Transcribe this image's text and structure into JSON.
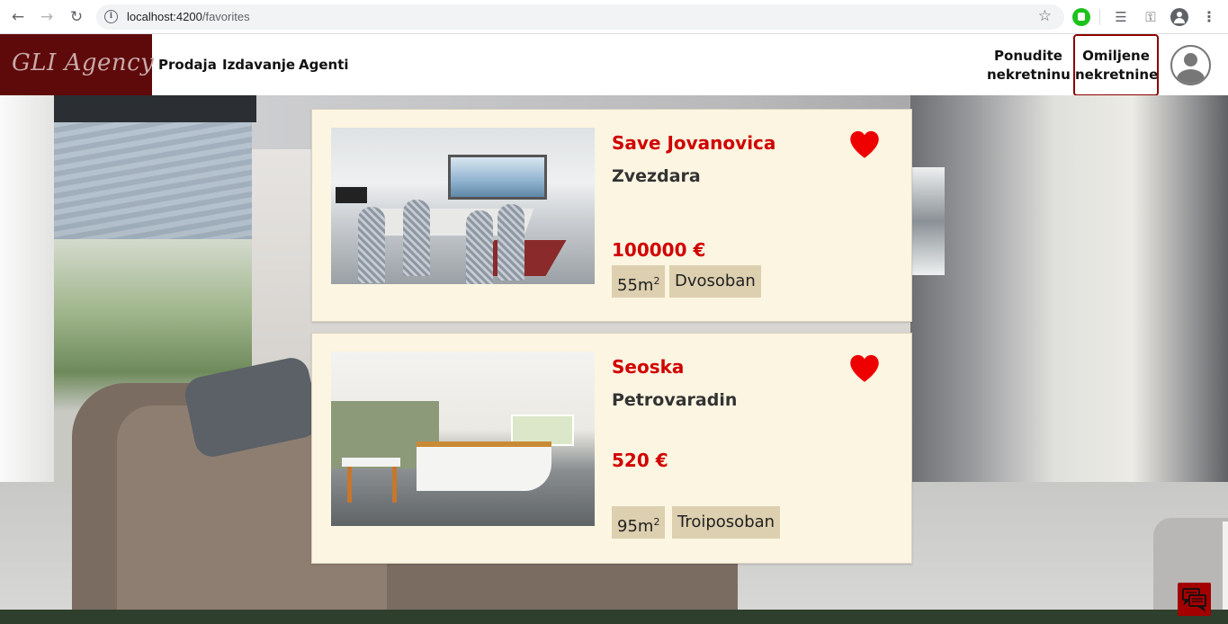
{
  "browser": {
    "url_host": "localhost:4200",
    "url_path": "/favorites"
  },
  "navbar": {
    "logo": "GLI Agency",
    "links": [
      "Prodaja",
      "Izdavanje",
      "Agenti"
    ],
    "offer_line1": "Ponudite",
    "offer_line2": "nekretninu",
    "favorites_line1": "Omiljene",
    "favorites_line2": "nekretnine"
  },
  "listings": [
    {
      "title": "Save Jovanovica",
      "location": "Zvezdara",
      "price": "100000 €",
      "area": "55m",
      "area_unit_sup": "2",
      "rooms": "Dvosoban",
      "favorite": true
    },
    {
      "title": "Seoska",
      "location": "Petrovaradin",
      "price": "520 €",
      "area": "95m",
      "area_unit_sup": "2",
      "rooms": "Troiposoban",
      "favorite": true
    }
  ],
  "colors": {
    "brand": "#5e0a0a",
    "accent": "#d10000",
    "card_bg": "#fbf5e1",
    "tag_bg": "#ddd0b0"
  }
}
